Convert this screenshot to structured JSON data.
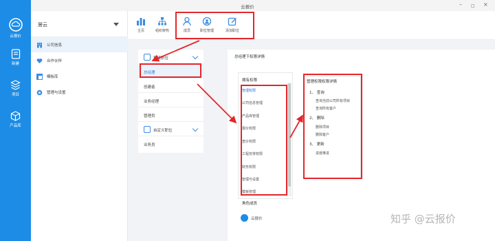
{
  "window": {
    "title": "云报价",
    "minimize": "–",
    "maximize": "□",
    "close": "×"
  },
  "rail": {
    "brand": "云报价",
    "items": [
      {
        "label": "新建",
        "icon": "document-icon"
      },
      {
        "label": "项目",
        "icon": "cube-stack-icon"
      },
      {
        "label": "产品库",
        "icon": "box-icon"
      }
    ]
  },
  "nav": {
    "org_name": "居云",
    "items": [
      {
        "label": "公司信息",
        "icon": "building-icon",
        "active": true
      },
      {
        "label": "合作伙伴",
        "icon": "heart-hand-icon",
        "active": false
      },
      {
        "label": "模板库",
        "icon": "template-icon",
        "active": false
      },
      {
        "label": "管理与设置",
        "icon": "gear-icon",
        "active": false
      }
    ]
  },
  "toolbar": {
    "items": [
      {
        "label": "主页",
        "icon": "chart-icon"
      },
      {
        "label": "组织架构",
        "icon": "org-tree-icon"
      },
      {
        "label": "成员",
        "icon": "member-icon"
      },
      {
        "label": "职位管理",
        "icon": "position-icon"
      },
      {
        "label": "添加职位",
        "icon": "edit-icon"
      }
    ]
  },
  "roles": {
    "group1": "预设职位",
    "items": [
      "总经理",
      "创建者",
      "业务经理",
      "管理员"
    ],
    "group2": "自定义职位",
    "custom_items": [
      "业务员"
    ]
  },
  "detail": {
    "title": "总经理下权限详情",
    "perm_header": "拥有权限",
    "permissions": [
      "管理权限",
      "公司信息管理",
      "产品库管理",
      "报价权限",
      "查价权限",
      "工程安排权限",
      "财务权限",
      "管理与设置",
      "模板管理"
    ],
    "roleset_header": "角色成员",
    "roleset_name": "云报价",
    "detail_header": "管理权限权限详情",
    "groups": [
      {
        "num": "1、",
        "name": "查询",
        "items": [
          "查询当前公司所有项目",
          "查询所有客户"
        ]
      },
      {
        "num": "2、",
        "name": "删除",
        "items": [
          "删除项目",
          "删除客户"
        ]
      },
      {
        "num": "3、",
        "name": "更新",
        "items": [
          "进度推进"
        ]
      }
    ]
  },
  "watermark": "知乎 @云报价",
  "colors": {
    "accent": "#1c8ce6",
    "highlight": "#e3262a",
    "active_text": "#2d78d8"
  }
}
